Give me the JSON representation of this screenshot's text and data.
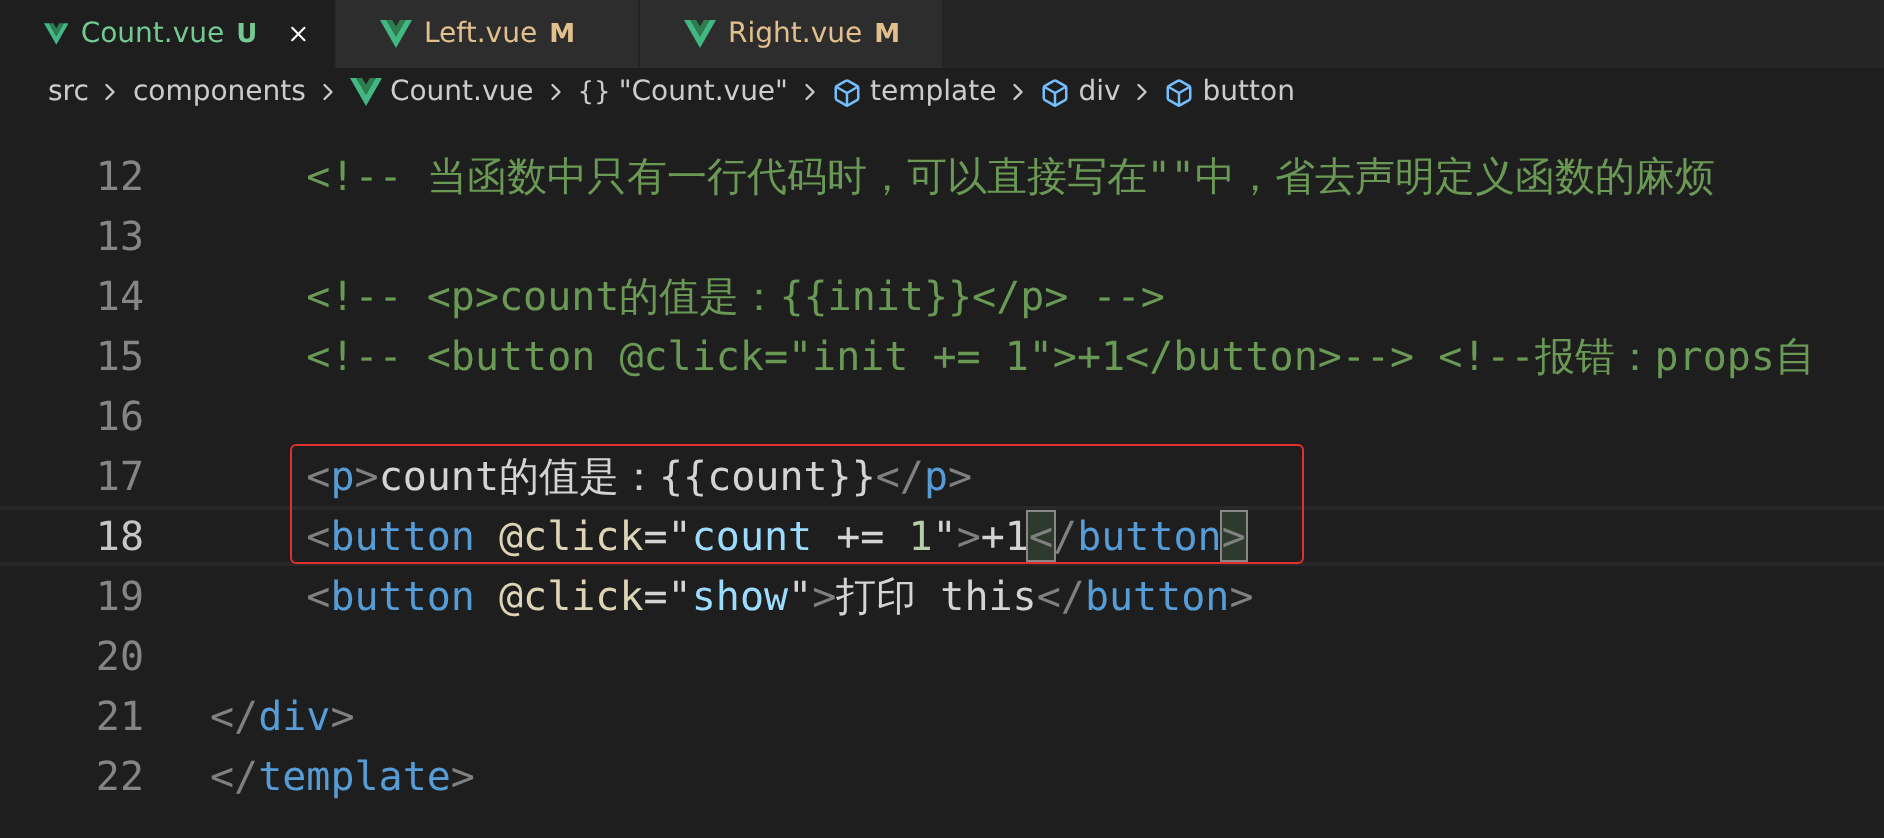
{
  "tabs": [
    {
      "label": "Count.vue",
      "status": "U",
      "color": "#73c991",
      "selected": true
    },
    {
      "label": "Left.vue",
      "status": "M",
      "color": "#e2c08d",
      "selected": false
    },
    {
      "label": "Right.vue",
      "status": "M",
      "color": "#e2c08d",
      "selected": false
    }
  ],
  "breadcrumb": [
    {
      "kind": "folder",
      "label": "src"
    },
    {
      "kind": "folder",
      "label": "components"
    },
    {
      "kind": "file",
      "label": "Count.vue"
    },
    {
      "kind": "object",
      "icon": "{}",
      "label": "\"Count.vue\""
    },
    {
      "kind": "element",
      "label": "template"
    },
    {
      "kind": "element",
      "label": "div"
    },
    {
      "kind": "element",
      "label": "button"
    }
  ],
  "editor": {
    "lines": [
      {
        "number": "12",
        "current": false,
        "tokens": [
          {
            "kind": "comment",
            "text": "    <!-- 当函数中只有一行代码时，可以直接写在\"\"中，省去声明定义函数的麻烦"
          }
        ]
      },
      {
        "number": "13",
        "current": false
      },
      {
        "number": "14",
        "current": false,
        "tokens": [
          {
            "kind": "comment",
            "text": "    <!-- <p>count的值是：{{init}}</p> -->"
          }
        ]
      },
      {
        "number": "15",
        "current": false,
        "tokens": [
          {
            "kind": "comment",
            "text": "    <!-- <button @click=\"init += 1\">+1</button>--> <!--报错：props自"
          }
        ]
      },
      {
        "number": "16",
        "current": false
      },
      {
        "number": "17",
        "current": false,
        "boxed": true,
        "tokens": [
          {
            "kind": "punct",
            "text": "    <"
          },
          {
            "kind": "tag",
            "text": "p"
          },
          {
            "kind": "punct",
            "text": ">"
          },
          {
            "kind": "text",
            "text": "count的值是：{{count}}"
          },
          {
            "kind": "punct",
            "text": "</"
          },
          {
            "kind": "tag",
            "text": "p"
          },
          {
            "kind": "punct",
            "text": ">"
          }
        ]
      },
      {
        "number": "18",
        "current": true,
        "boxed": true,
        "tokens": [
          {
            "kind": "punct",
            "text": "    <"
          },
          {
            "kind": "tag",
            "text": "button"
          },
          {
            "kind": "attr",
            "text": " @click"
          },
          {
            "kind": "text",
            "text": "=\""
          },
          {
            "kind": "variable",
            "text": "count"
          },
          {
            "kind": "text",
            "text": " += "
          },
          {
            "kind": "number",
            "text": "1"
          },
          {
            "kind": "text",
            "text": "\""
          },
          {
            "kind": "punct",
            "text": ">"
          },
          {
            "kind": "text",
            "text": "+1"
          },
          {
            "kind": "punct",
            "text": "<",
            "matched": true
          },
          {
            "kind": "punct",
            "text": "/"
          },
          {
            "kind": "tag",
            "text": "button"
          },
          {
            "kind": "punct",
            "text": ">",
            "matched": true
          }
        ]
      },
      {
        "number": "19",
        "current": false,
        "tokens": [
          {
            "kind": "punct",
            "text": "    <"
          },
          {
            "kind": "tag",
            "text": "button"
          },
          {
            "kind": "attr",
            "text": " @click"
          },
          {
            "kind": "text",
            "text": "=\""
          },
          {
            "kind": "variable",
            "text": "show"
          },
          {
            "kind": "text",
            "text": "\""
          },
          {
            "kind": "punct",
            "text": ">"
          },
          {
            "kind": "text",
            "text": "打印 this"
          },
          {
            "kind": "punct",
            "text": "</"
          },
          {
            "kind": "tag",
            "text": "button"
          },
          {
            "kind": "punct",
            "text": ">"
          }
        ]
      },
      {
        "number": "20",
        "current": false
      },
      {
        "number": "21",
        "current": false,
        "tokens": [
          {
            "kind": "punct",
            "text": "</"
          },
          {
            "kind": "tag",
            "text": "div"
          },
          {
            "kind": "punct",
            "text": ">"
          }
        ]
      },
      {
        "number": "22",
        "current": false,
        "tokens": [
          {
            "kind": "punct",
            "text": "</"
          },
          {
            "kind": "tag",
            "text": "template"
          },
          {
            "kind": "punct",
            "text": ">"
          }
        ]
      }
    ]
  }
}
